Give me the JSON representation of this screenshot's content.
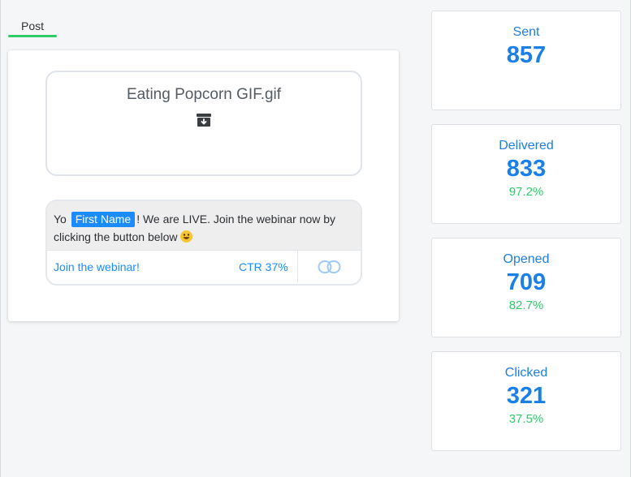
{
  "tab": {
    "label": "Post"
  },
  "post": {
    "attachment_name": "Eating Popcorn GIF.gif",
    "attachment_icon": "archive-download-icon",
    "message": {
      "greeting": "Yo",
      "merge_tag": "First Name",
      "line1_rest": "! We are LIVE. Join the webinar now by",
      "line2": "clicking the button below",
      "emoji": "grinning-face-emoji"
    },
    "button": {
      "label": "Join the webinar!",
      "ctr": "CTR 37%",
      "icon": "link-icon"
    }
  },
  "stats": [
    {
      "title": "Sent",
      "value": "857",
      "pct": ""
    },
    {
      "title": "Delivered",
      "value": "833",
      "pct": "97.2%"
    },
    {
      "title": "Opened",
      "value": "709",
      "pct": "82.7%"
    },
    {
      "title": "Clicked",
      "value": "321",
      "pct": "37.5%"
    }
  ],
  "colors": {
    "accent_blue": "#1a8cff",
    "stat_blue": "#1a7fe6",
    "success_green": "#2fcb6a"
  }
}
